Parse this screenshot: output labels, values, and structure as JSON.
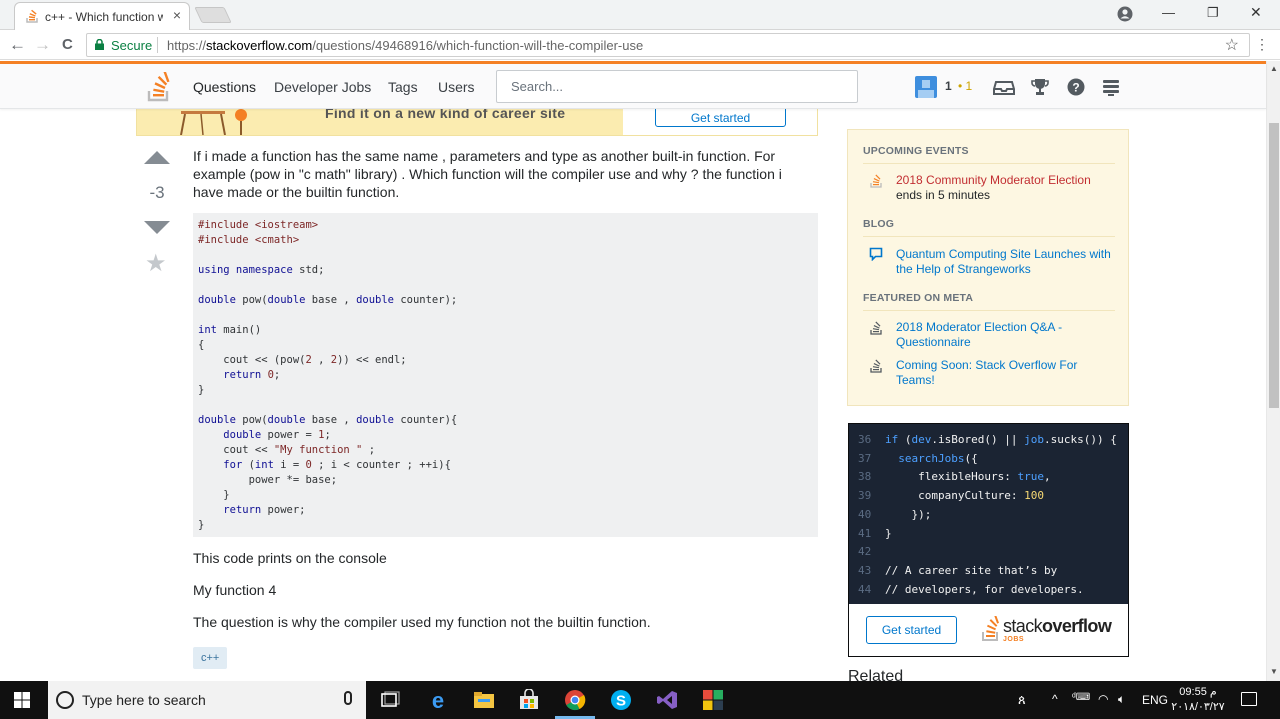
{
  "browser": {
    "tab_title": "c++ - Which function wil",
    "tab_close": "×",
    "secure_label": "Secure",
    "url_scheme": "https://",
    "url_domain": "stackoverflow.com",
    "url_path": "/questions/49468916/which-function-will-the-compiler-use",
    "back": "←",
    "forward": "→",
    "reload": "C",
    "star": "☆",
    "menu": "⋮",
    "win_minimize": "—",
    "win_restore": "❐",
    "win_close": "✕"
  },
  "topbar": {
    "nav": [
      "Questions",
      "Developer Jobs",
      "Tags",
      "Users"
    ],
    "search_placeholder": "Search...",
    "reputation": "1",
    "badge": "• 1"
  },
  "banner": {
    "text": "Find it on a new kind of career site",
    "button": "Get started"
  },
  "question": {
    "votes": "-3",
    "body": "If i made a function has the same name , parameters and type as another built-in function. For example (pow in \"c math\" library) . Which function will the compiler use and why ? the function i have made or the builtin function.",
    "output_intro": "This code prints on the console",
    "output": "My function 4",
    "closing": "The question is why the compiler used my function not the builtin function.",
    "tag": "c++"
  },
  "sidebar": {
    "upcoming_header": "UPCOMING EVENTS",
    "event_title": "2018 Community Moderator Election",
    "event_sub": "ends in 5 minutes",
    "blog_header": "BLOG",
    "blog_item": "Quantum Computing Site Launches with the Help of Strangeworks",
    "meta_header": "FEATURED ON META",
    "meta_items": [
      "2018 Moderator Election Q&A - Questionnaire",
      "Coming Soon: Stack Overflow For Teams!"
    ]
  },
  "jobs_ad": {
    "line_numbers": [
      "36",
      "37",
      "38",
      "39",
      "40",
      "41",
      "42",
      "43",
      "44"
    ],
    "button": "Get started",
    "logo_word_a": "stack",
    "logo_word_b": "overflow",
    "logo_jobs": "JOBS"
  },
  "related_header": "Related",
  "taskbar": {
    "search_text": "Type here to search",
    "language": "ENG",
    "time": "09:55 م",
    "date": "٢٠١٨/٠٣/٢٧"
  },
  "colors": {
    "so_orange": "#f48024",
    "link_blue": "#0077cc",
    "sidebar_bg": "#fdf7e2",
    "code_bg": "#eff0f1",
    "ad_bg": "#1b2433"
  }
}
